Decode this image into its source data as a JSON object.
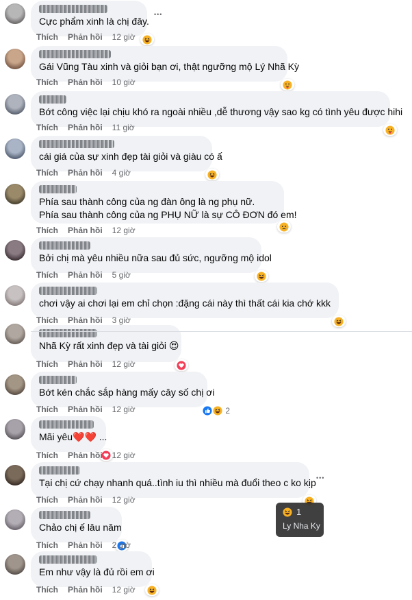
{
  "actions": {
    "like": "Thích",
    "reply": "Phản hồi"
  },
  "colors": {
    "bubble": "#f0f2f5",
    "meta": "#65676b",
    "haha": "#f7b125",
    "love": "#f33e58",
    "like": "#1877f2"
  },
  "more_icon": "more-horizontal-icon",
  "comments": [
    {
      "lines": [
        "Cực phẩm xinh là chị đây."
      ],
      "time": "12 giờ",
      "reactions": [
        "haha"
      ],
      "count": ""
    },
    {
      "lines": [
        "Gái Vũng Tàu xinh và giỏi bạn ơi, thật ngưỡng mộ Lý Nhã Kỳ"
      ],
      "time": "10 giờ",
      "reactions": [
        "care"
      ],
      "count": ""
    },
    {
      "lines": [
        "Bớt công việc lại chịu khó ra ngoài nhiều ,dễ thương vậy sao kg có tình yêu được hihi"
      ],
      "time": "11 giờ",
      "reactions": [
        "care"
      ],
      "count": ""
    },
    {
      "lines": [
        "cái giá của sự xinh đẹp tài giỏi và giàu có ấ"
      ],
      "time": "4 giờ",
      "reactions": [
        "haha"
      ],
      "count": ""
    },
    {
      "lines": [
        "Phía sau thành công của ng đàn ông là ng phụ nữ.",
        "Phía sau thành công của ng PHỤ NỮ là sự CÔ ĐƠN đó em!"
      ],
      "time": "12 giờ",
      "reactions": [
        "sad"
      ],
      "count": ""
    },
    {
      "lines": [
        "Bởi chị mà yêu nhiều nữa sau đủ sức, ngưỡng mộ idol"
      ],
      "time": "5 giờ",
      "reactions": [
        "haha"
      ],
      "count": ""
    },
    {
      "lines": [
        "chơi vậy ai chơi lại em chỉ chọn :đặng cái này thì thất cái kia chớ kkk"
      ],
      "time": "3 giờ",
      "reactions": [
        "haha"
      ],
      "count": ""
    },
    {
      "lines": [
        "Nhã Kỳ rất xinh đẹp và tài giỏi 😍"
      ],
      "time": "12 giờ",
      "reactions": [
        "love"
      ],
      "count": ""
    },
    {
      "lines": [
        "Bớt kén chắc sắp hàng mấy cây số chị ơi"
      ],
      "time": "12 giờ",
      "reactions": [
        "like",
        "haha"
      ],
      "count": "2"
    },
    {
      "lines": [
        "Mãi yêu❤️❤️ ..."
      ],
      "time": "12 giờ",
      "reactions": [
        "love"
      ],
      "count": ""
    },
    {
      "lines": [
        "Tại chị cứ chạy nhanh quá..tình iu thì nhiều mà đuổi theo c ko kịp"
      ],
      "time": "12 giờ",
      "reactions": [
        "haha"
      ],
      "count": ""
    },
    {
      "lines": [
        "Chảo chị ế lâu năm"
      ],
      "time": "2 giờ",
      "reactions": [
        "like"
      ],
      "count": ""
    },
    {
      "lines": [
        "Em như vậy là đủ rồi em ơi"
      ],
      "time": "12 giờ",
      "reactions": [
        "haha"
      ],
      "count": ""
    }
  ],
  "tooltip": {
    "count": "1",
    "name": "Ly Nha Ky",
    "reaction": "haha"
  }
}
